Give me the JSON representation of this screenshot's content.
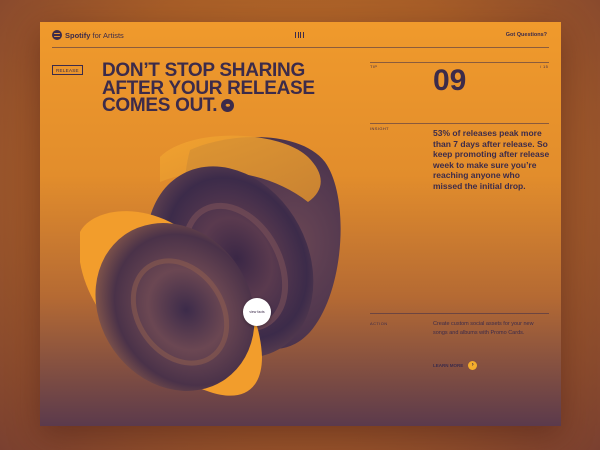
{
  "header": {
    "brand": "Spotify",
    "brand_suffix": "for Artists",
    "logo_icon": "spotify-logo-icon",
    "menu_icon": "menu-bars-icon",
    "questions_label": "Got Questions?"
  },
  "hero": {
    "tag": "RELEASE",
    "title_line1": "DON’T STOP SHARING",
    "title_line2": "AFTER YOUR RELEASE",
    "title_line3": "COMES OUT.",
    "link_icon": "link-icon",
    "view_button": "view facts"
  },
  "tip": {
    "tip_label": "TIP",
    "page_total": "/ 15",
    "number": "09",
    "insight_label": "INSIGHT",
    "insight_text": "53% of releases peak more than 7 days after release. So keep promoting after release week to make sure you’re reaching anyone who missed the initial drop.",
    "action_label": "ACTION",
    "action_text": "Create custom social assets for your new songs and albums with Promo Cards.",
    "learn_more": "LEARN MORE",
    "arrow_icon": "arrow-right-icon"
  },
  "colors": {
    "orange": "#f09a2c",
    "purple": "#3c2b4a",
    "bright_orange": "#f3ad2c"
  }
}
